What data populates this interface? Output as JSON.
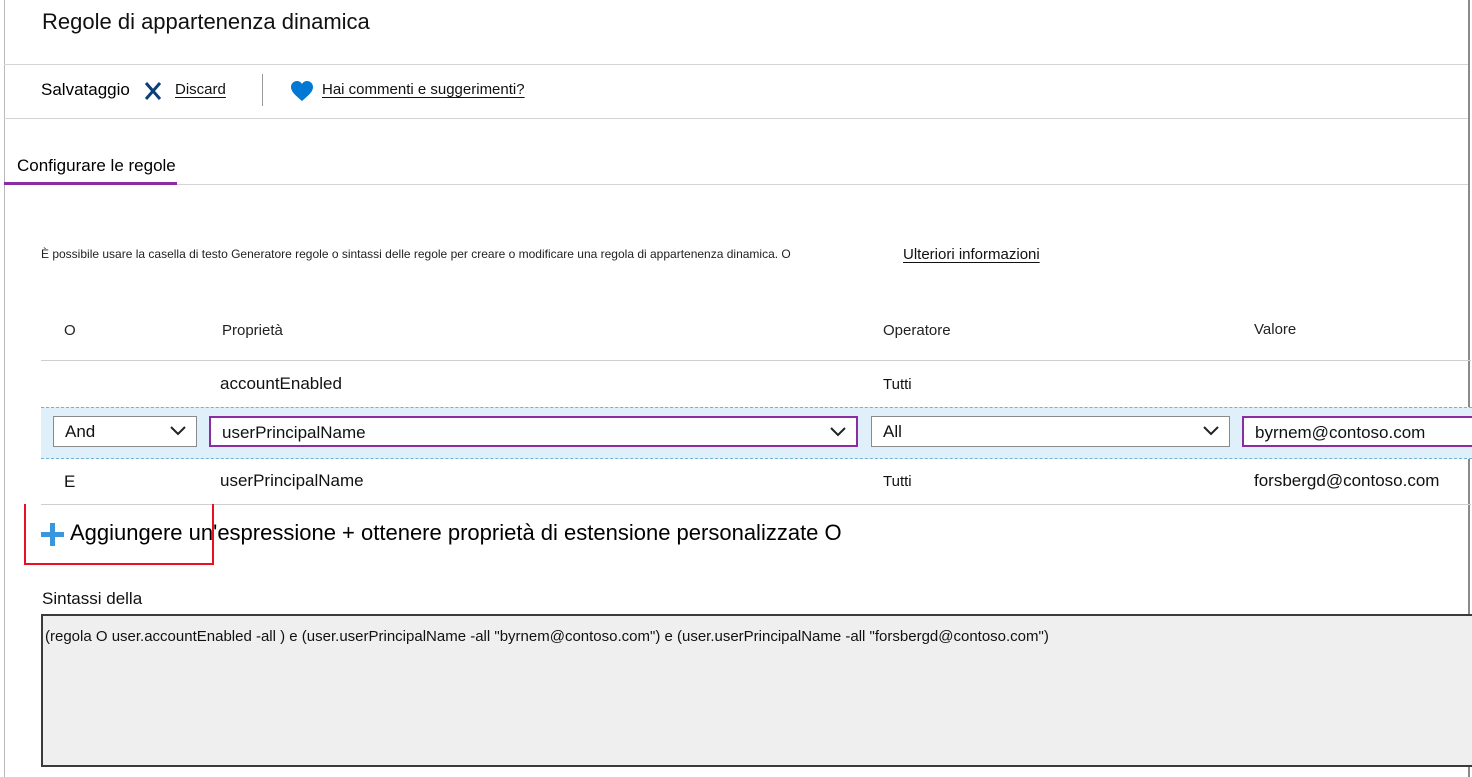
{
  "title": "Regole di appartenenza dinamica",
  "toolbar": {
    "save_label": "Salvataggio",
    "discard_label": "Discard",
    "feedback_label": "Hai commenti e suggerimenti?"
  },
  "tab": {
    "label": "Configurare le regole"
  },
  "description": "È possibile usare la casella di testo Generatore regole o sintassi delle regole per creare o modificare una regola di appartenenza dinamica. O",
  "more_info_link": "Ulteriori informazioni",
  "table": {
    "headers": {
      "or": "O",
      "property": "Proprietà",
      "operator": "Operatore",
      "value": "Valore"
    },
    "rows": [
      {
        "and_or": "",
        "property": "accountEnabled",
        "operator": "Tutti",
        "value": ""
      },
      {
        "and_or": "And",
        "property": "userPrincipalName",
        "operator": "All",
        "value": "byrnem@contoso.com"
      },
      {
        "and_or": "E",
        "property": "userPrincipalName",
        "operator": "Tutti",
        "value": "forsbergd@contoso.com"
      }
    ]
  },
  "add_expression": "Aggiungere un'espressione + ottenere proprietà di estensione personalizzate O",
  "syntax": {
    "label": "Sintassi della",
    "text": "(regola O user.accountEnabled -all ) e (user.userPrincipalName -all \"byrnem@contoso.com\") e (user.userPrincipalName -all \"forsbergd@contoso.com\")"
  },
  "colors": {
    "accent": "#8a2da5",
    "heart": "#0078d4",
    "plus": "#3a96dd",
    "highlight_border": "#e81123",
    "edit_row_bg": "#dff0fa"
  },
  "icons": {
    "discard": "discard-x-icon",
    "feedback": "heart-icon",
    "add": "plus-icon",
    "dropdown": "chevron-down-icon"
  }
}
